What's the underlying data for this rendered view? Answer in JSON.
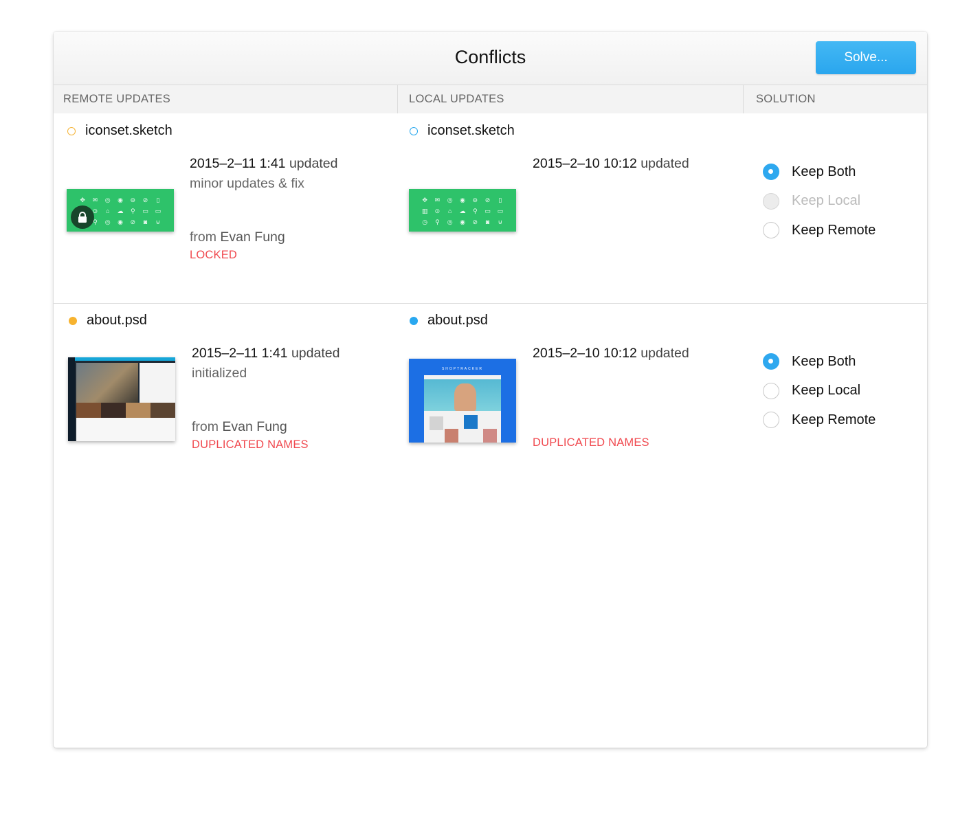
{
  "window": {
    "title": "Conflicts",
    "solve_label": "Solve..."
  },
  "columns": [
    "REMOTE UPDATES",
    "LOCAL UPDATES",
    "SOLUTION"
  ],
  "rows": [
    {
      "remote": {
        "filename": "iconset.sketch",
        "date": "2015–2–11 1:41",
        "updated": "updated",
        "note": "minor updates & fix",
        "from_prefix": "from",
        "author": "Evan Fung",
        "status": "LOCKED"
      },
      "local": {
        "filename": "iconset.sketch",
        "date": "2015–2–10 10:12",
        "updated": "updated"
      },
      "options": [
        "Keep Both",
        "Keep Local",
        "Keep Remote"
      ]
    },
    {
      "remote": {
        "filename": "about.psd",
        "date": "2015–2–11 1:41",
        "updated": "updated",
        "note": "initialized",
        "from_prefix": "from",
        "author": "Evan Fung",
        "status": "DUPLICATED NAMES"
      },
      "local": {
        "filename": "about.psd",
        "date": "2015–2–10 10:12",
        "updated": "updated",
        "status": "DUPLICATED NAMES"
      },
      "options": [
        "Keep Both",
        "Keep Local",
        "Keep Remote"
      ]
    }
  ],
  "thumbnails": {
    "shoptracker_brand": "SHOPTRACKER"
  },
  "colors": {
    "accent": "#2ea8ef",
    "warning": "#f0494f",
    "remote_dot": "#f7b32f",
    "local_dot": "#29a8f0",
    "sketch_thumb": "#2ec26a"
  }
}
